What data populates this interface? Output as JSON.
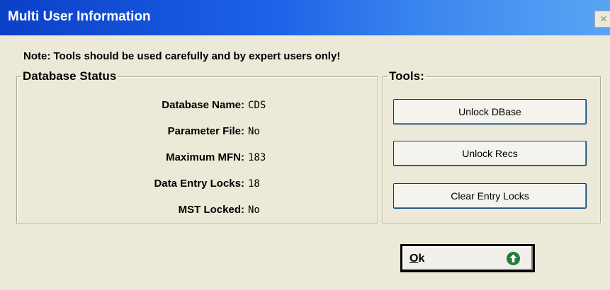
{
  "window": {
    "title": "Multi User Information",
    "close_symbol": "×"
  },
  "note": "Note: Tools should be used carefully and by expert users only!",
  "database_status": {
    "legend": "Database Status",
    "rows": [
      {
        "label": "Database Name:",
        "value": "CDS"
      },
      {
        "label": "Parameter File:",
        "value": "No"
      },
      {
        "label": "Maximum MFN:",
        "value": "183"
      },
      {
        "label": "Data Entry Locks:",
        "value": "18"
      },
      {
        "label": "MST Locked:",
        "value": "No"
      }
    ]
  },
  "tools": {
    "legend": "Tools:",
    "buttons": [
      "Unlock DBase",
      "Unlock Recs",
      "Clear Entry Locks"
    ]
  },
  "ok_button": {
    "accel": "O",
    "rest": "k",
    "icon": "green-up-arrow-icon"
  }
}
